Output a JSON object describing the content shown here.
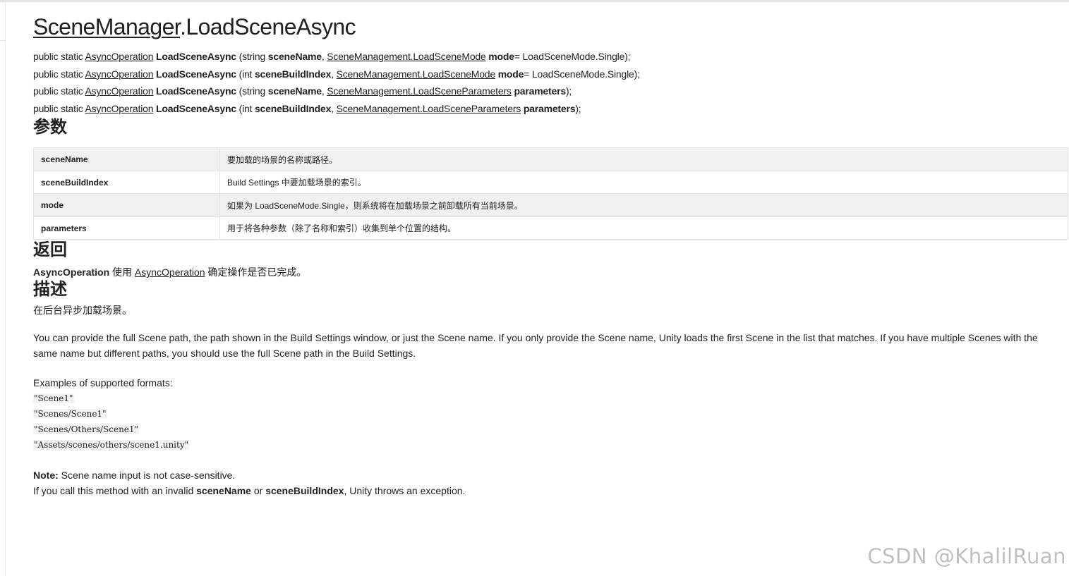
{
  "title": {
    "class_name": "SceneManager",
    "method": ".LoadSceneAsync"
  },
  "signatures": [
    {
      "prefix": "public static ",
      "return_type": "AsyncOperation",
      "method": "LoadSceneAsync",
      "open": " (",
      "p1_type": "string ",
      "p1_name": "sceneName",
      "sep": ", ",
      "p2_type": "SceneManagement.LoadSceneMode",
      "p2_space": " ",
      "p2_name": "mode",
      "tail": "= LoadSceneMode.Single);"
    },
    {
      "prefix": "public static ",
      "return_type": "AsyncOperation",
      "method": "LoadSceneAsync",
      "open": " (",
      "p1_type": "int ",
      "p1_name": "sceneBuildIndex",
      "sep": ", ",
      "p2_type": "SceneManagement.LoadSceneMode",
      "p2_space": " ",
      "p2_name": "mode",
      "tail": "= LoadSceneMode.Single);"
    },
    {
      "prefix": "public static ",
      "return_type": "AsyncOperation",
      "method": "LoadSceneAsync",
      "open": " (",
      "p1_type": "string ",
      "p1_name": "sceneName",
      "sep": ", ",
      "p2_type": "SceneManagement.LoadSceneParameters",
      "p2_space": " ",
      "p2_name": "parameters",
      "tail": ");"
    },
    {
      "prefix": "public static ",
      "return_type": "AsyncOperation",
      "method": "LoadSceneAsync",
      "open": " (",
      "p1_type": "int ",
      "p1_name": "sceneBuildIndex",
      "sep": ", ",
      "p2_type": "SceneManagement.LoadSceneParameters",
      "p2_space": " ",
      "p2_name": "parameters",
      "tail": ");"
    }
  ],
  "params": {
    "heading": "参数",
    "rows": [
      {
        "name": "sceneName",
        "desc": "要加载的场景的名称或路径。"
      },
      {
        "name": "sceneBuildIndex",
        "desc": "Build Settings 中要加载场景的索引。"
      },
      {
        "name": "mode",
        "desc": "如果为 LoadSceneMode.Single，则系统将在加载场景之前卸载所有当前场景。"
      },
      {
        "name": "parameters",
        "desc": "用于将各种参数（除了名称和索引）收集到单个位置的结构。"
      }
    ]
  },
  "returns": {
    "heading": "返回",
    "type": "AsyncOperation",
    "text_before": " 使用 ",
    "link": "AsyncOperation",
    "text_after": " 确定操作是否已完成。"
  },
  "description": {
    "heading": "描述",
    "short": "在后台异步加载场景。",
    "long": "You can provide the full Scene path, the path shown in the Build Settings window, or just the Scene name. If you only provide the Scene name, Unity loads the first Scene in the list that matches. If you have multiple Scenes with the same name but different paths, you should use the full Scene path in the Build Settings.",
    "examples_label": "Examples of supported formats:",
    "examples": [
      "\"Scene1\"",
      "\"Scenes/Scene1\"",
      "\"Scenes/Others/Scene1\"",
      "\"Assets/scenes/others/scene1.unity\""
    ],
    "note_label": "Note:",
    "note_text": " Scene name input is not case-sensitive.",
    "error_p1": "If you call this method with an invalid ",
    "error_b1": "sceneName",
    "error_p2": " or ",
    "error_b2": "sceneBuildIndex",
    "error_p3": ", Unity throws an exception."
  },
  "watermark": "CSDN @KhalilRuan"
}
